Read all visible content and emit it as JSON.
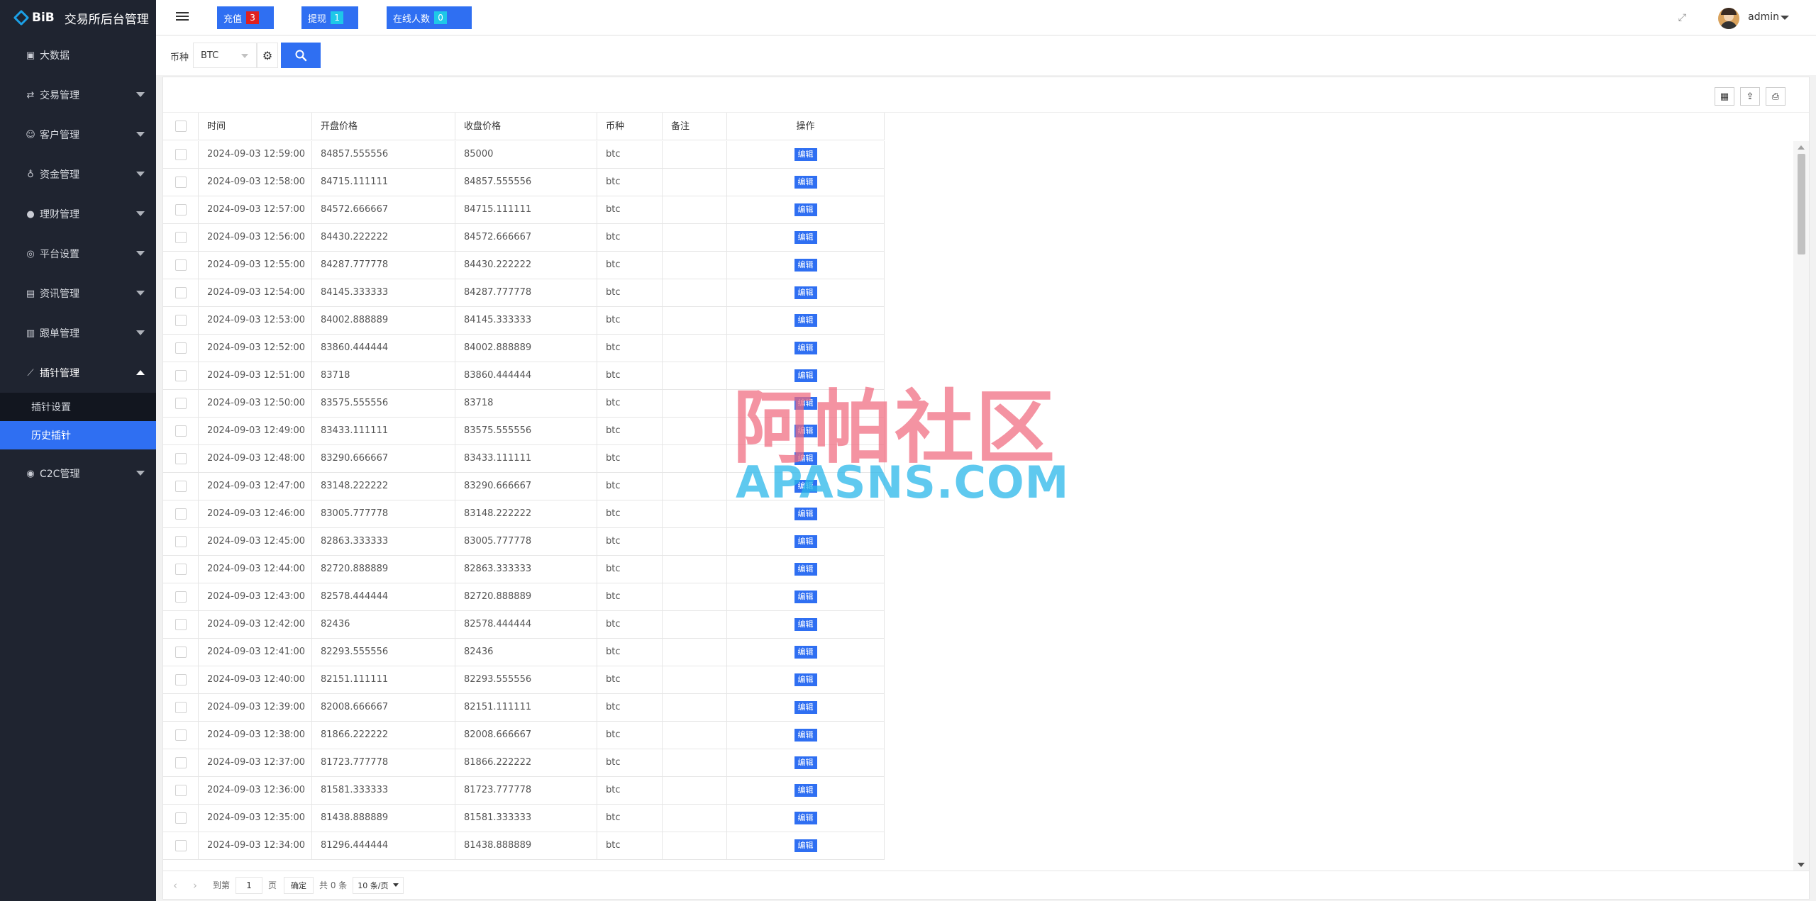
{
  "brand": {
    "logo_text": "BiB",
    "title": "交易所后台管理"
  },
  "sidebar": {
    "items": [
      {
        "label": "大数据",
        "icon": "dashboard-icon",
        "caret": false
      },
      {
        "label": "交易管理",
        "icon": "exchange-icon",
        "caret": true
      },
      {
        "label": "客户管理",
        "icon": "users-icon",
        "caret": true
      },
      {
        "label": "资金管理",
        "icon": "money-bag-icon",
        "caret": true
      },
      {
        "label": "理财管理",
        "icon": "piggy-bank-icon",
        "caret": true
      },
      {
        "label": "平台设置",
        "icon": "settings-icon",
        "caret": true
      },
      {
        "label": "资讯管理",
        "icon": "news-icon",
        "caret": true
      },
      {
        "label": "跟单管理",
        "icon": "copy-order-icon",
        "caret": true
      },
      {
        "label": "插针管理",
        "icon": "wand-icon",
        "caret": true,
        "open": true
      }
    ],
    "sub_items": [
      {
        "label": "插针设置",
        "active": false
      },
      {
        "label": "历史插针",
        "active": true
      }
    ],
    "after_items": [
      {
        "label": "C2C管理",
        "icon": "c2c-icon",
        "caret": true
      }
    ]
  },
  "header": {
    "recharge_label": "充值",
    "recharge_count": "3",
    "withdraw_label": "提现",
    "withdraw_count": "1",
    "online_label": "在线人数",
    "online_count": "0",
    "username": "admin"
  },
  "filter": {
    "coin_label": "币种",
    "coin_value": "BTC"
  },
  "table": {
    "columns": [
      "时间",
      "开盘价格",
      "收盘价格",
      "币种",
      "备注",
      "操作"
    ],
    "edit_label": "编辑",
    "rows": [
      [
        "2024-09-03 12:59:00",
        "84857.555556",
        "85000",
        "btc",
        ""
      ],
      [
        "2024-09-03 12:58:00",
        "84715.111111",
        "84857.555556",
        "btc",
        ""
      ],
      [
        "2024-09-03 12:57:00",
        "84572.666667",
        "84715.111111",
        "btc",
        ""
      ],
      [
        "2024-09-03 12:56:00",
        "84430.222222",
        "84572.666667",
        "btc",
        ""
      ],
      [
        "2024-09-03 12:55:00",
        "84287.777778",
        "84430.222222",
        "btc",
        ""
      ],
      [
        "2024-09-03 12:54:00",
        "84145.333333",
        "84287.777778",
        "btc",
        ""
      ],
      [
        "2024-09-03 12:53:00",
        "84002.888889",
        "84145.333333",
        "btc",
        ""
      ],
      [
        "2024-09-03 12:52:00",
        "83860.444444",
        "84002.888889",
        "btc",
        ""
      ],
      [
        "2024-09-03 12:51:00",
        "83718",
        "83860.444444",
        "btc",
        ""
      ],
      [
        "2024-09-03 12:50:00",
        "83575.555556",
        "83718",
        "btc",
        ""
      ],
      [
        "2024-09-03 12:49:00",
        "83433.111111",
        "83575.555556",
        "btc",
        ""
      ],
      [
        "2024-09-03 12:48:00",
        "83290.666667",
        "83433.111111",
        "btc",
        ""
      ],
      [
        "2024-09-03 12:47:00",
        "83148.222222",
        "83290.666667",
        "btc",
        ""
      ],
      [
        "2024-09-03 12:46:00",
        "83005.777778",
        "83148.222222",
        "btc",
        ""
      ],
      [
        "2024-09-03 12:45:00",
        "82863.333333",
        "83005.777778",
        "btc",
        ""
      ],
      [
        "2024-09-03 12:44:00",
        "82720.888889",
        "82863.333333",
        "btc",
        ""
      ],
      [
        "2024-09-03 12:43:00",
        "82578.444444",
        "82720.888889",
        "btc",
        ""
      ],
      [
        "2024-09-03 12:42:00",
        "82436",
        "82578.444444",
        "btc",
        ""
      ],
      [
        "2024-09-03 12:41:00",
        "82293.555556",
        "82436",
        "btc",
        ""
      ],
      [
        "2024-09-03 12:40:00",
        "82151.111111",
        "82293.555556",
        "btc",
        ""
      ],
      [
        "2024-09-03 12:39:00",
        "82008.666667",
        "82151.111111",
        "btc",
        ""
      ],
      [
        "2024-09-03 12:38:00",
        "81866.222222",
        "82008.666667",
        "btc",
        ""
      ],
      [
        "2024-09-03 12:37:00",
        "81723.777778",
        "81866.222222",
        "btc",
        ""
      ],
      [
        "2024-09-03 12:36:00",
        "81581.333333",
        "81723.777778",
        "btc",
        ""
      ],
      [
        "2024-09-03 12:35:00",
        "81438.888889",
        "81581.333333",
        "btc",
        ""
      ],
      [
        "2024-09-03 12:34:00",
        "81296.444444",
        "81438.888889",
        "btc",
        ""
      ]
    ]
  },
  "pagination": {
    "goto_label": "到第",
    "page_value": "1",
    "page_suffix": "页",
    "confirm_label": "确定",
    "total_label": "共 0 条",
    "per_page": "10 条/页"
  },
  "watermark": {
    "cn": "阿帕社区",
    "en": "APASNS.COM"
  },
  "colors": {
    "accent": "#2f6ff2",
    "sidebar_bg": "#1f2430",
    "badge_red": "#e02020",
    "badge_cyan": "#1ec8e8"
  }
}
